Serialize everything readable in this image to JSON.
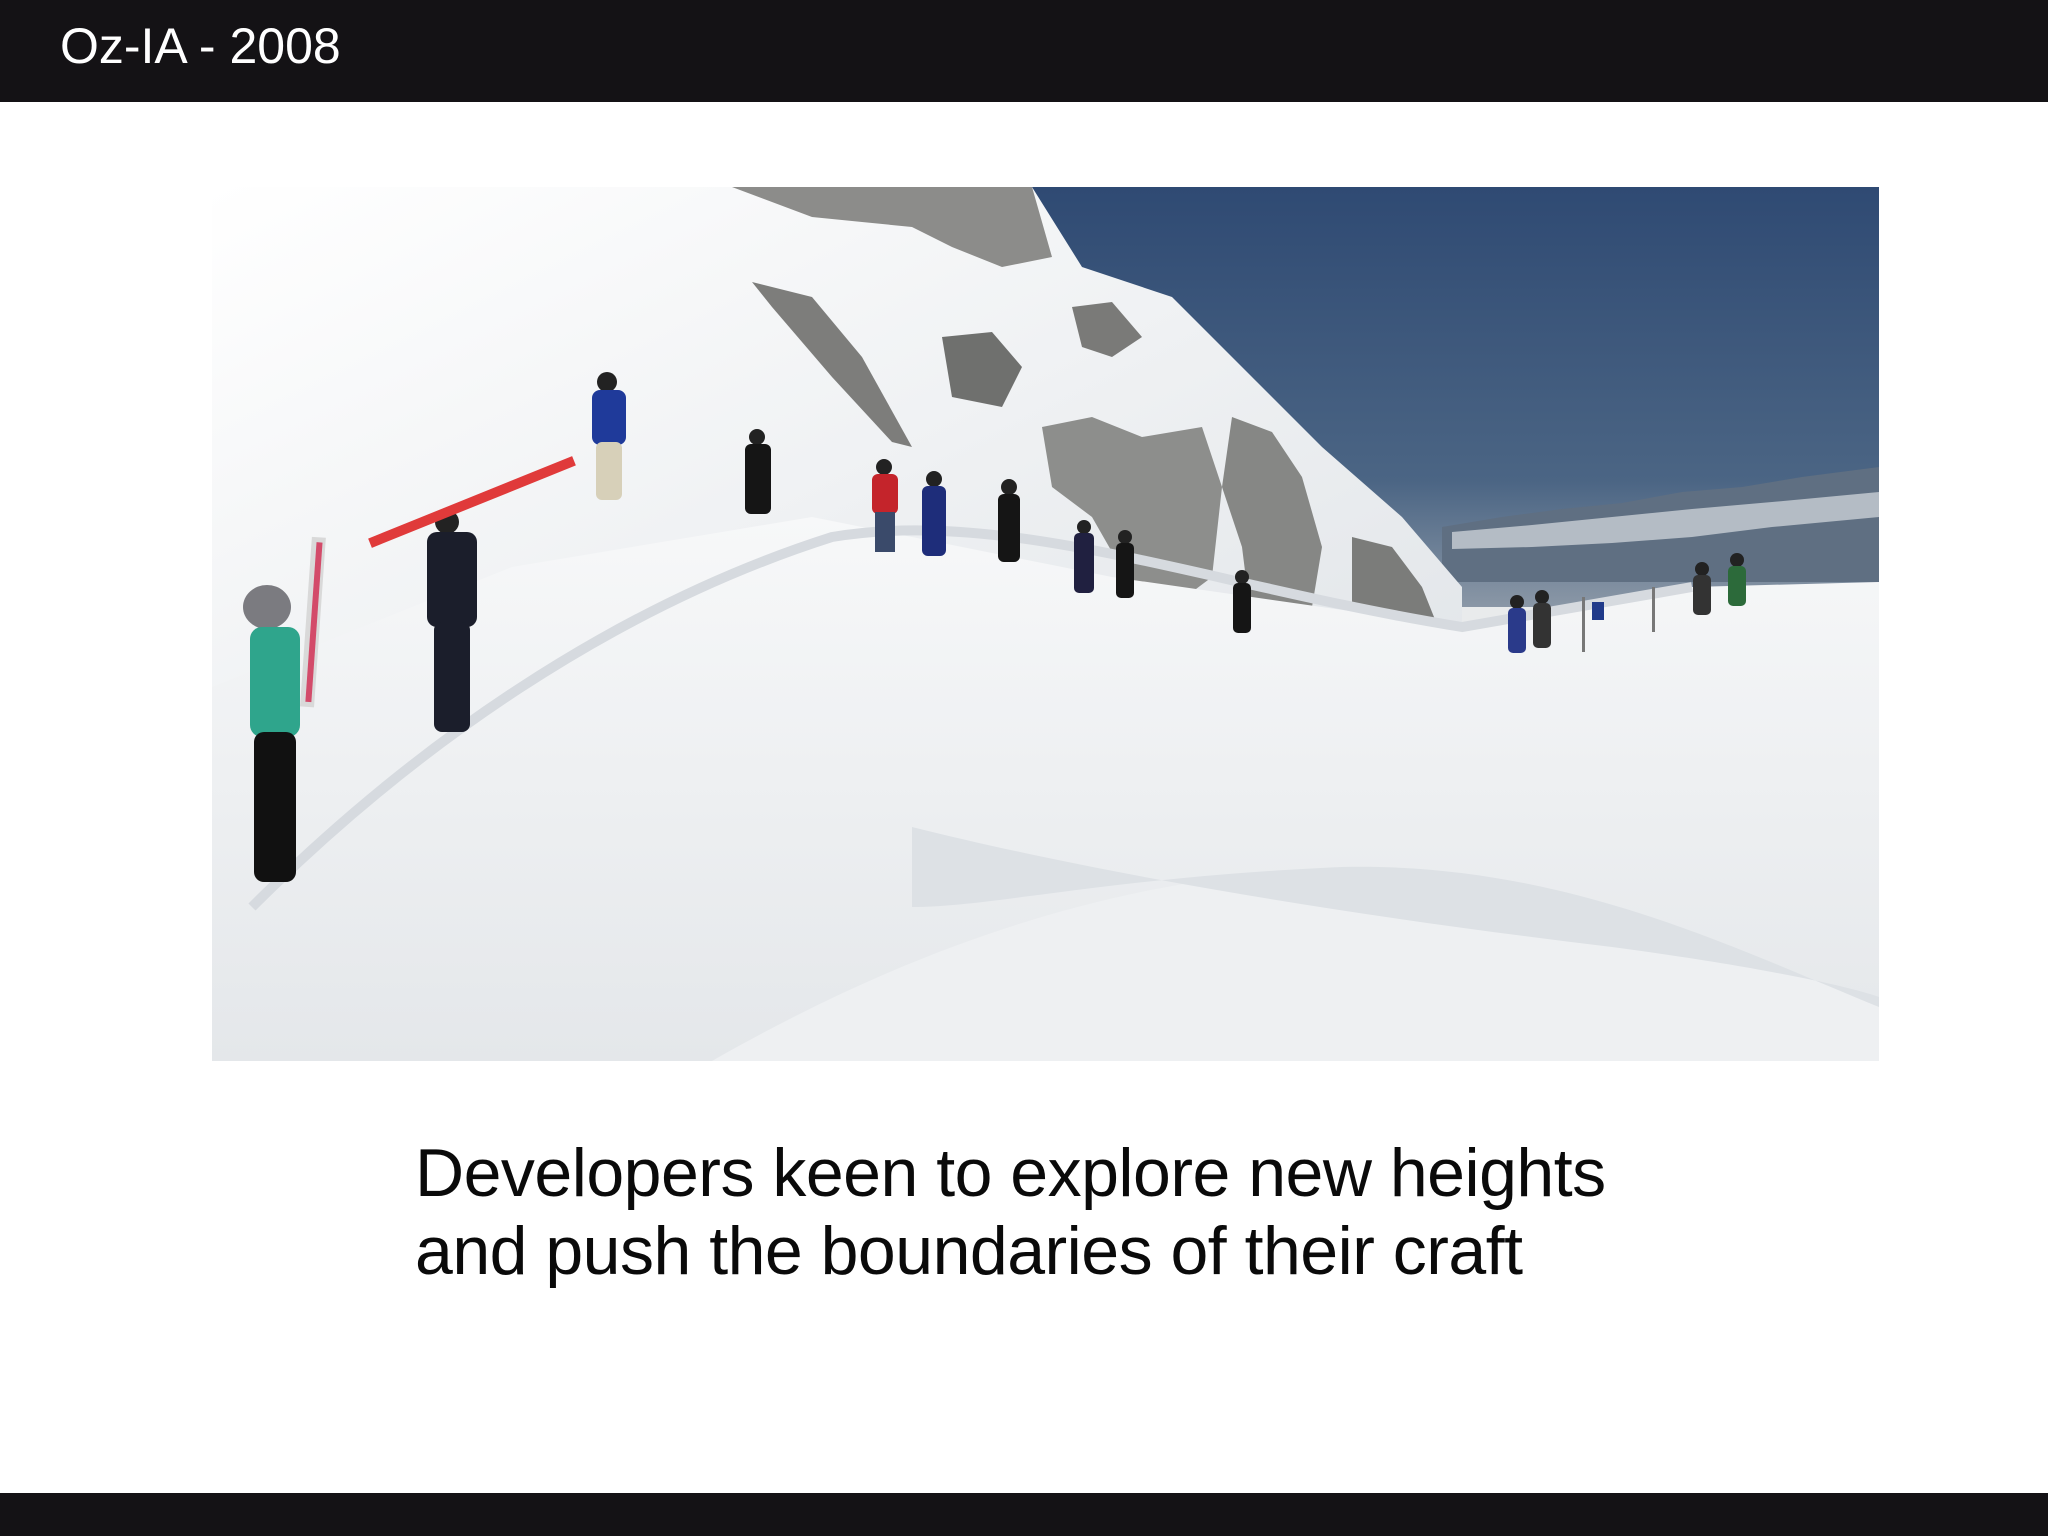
{
  "slide": {
    "header_title": "Oz-IA - 2008",
    "caption_lines": [
      "Developers keen to explore new heights",
      "and push the boundaries of their craft"
    ]
  },
  "colors": {
    "header_bg": "#141215",
    "slide_bg": "#ffffff",
    "caption_text": "#0a0a0a",
    "sky": "#3f5a7e",
    "snow": "#f3f4f5"
  },
  "photo": {
    "subject": "skiers-hiking-snowy-ridge"
  }
}
